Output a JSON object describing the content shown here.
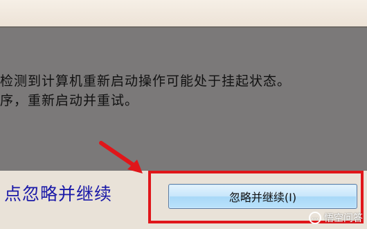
{
  "dialog": {
    "message_line1": "检测到计算机重新启动操作可能处于挂起状态。",
    "message_line2": "序，重新启动并重试。"
  },
  "annotation": {
    "hint_text": "点忽略并继续",
    "hint_color": "#1b1aa8",
    "highlight_color": "#e0161a"
  },
  "button": {
    "label": "忽略并继续(I)"
  },
  "watermark": {
    "icon": "speech-bubble-icon",
    "text": "悟空问答"
  }
}
